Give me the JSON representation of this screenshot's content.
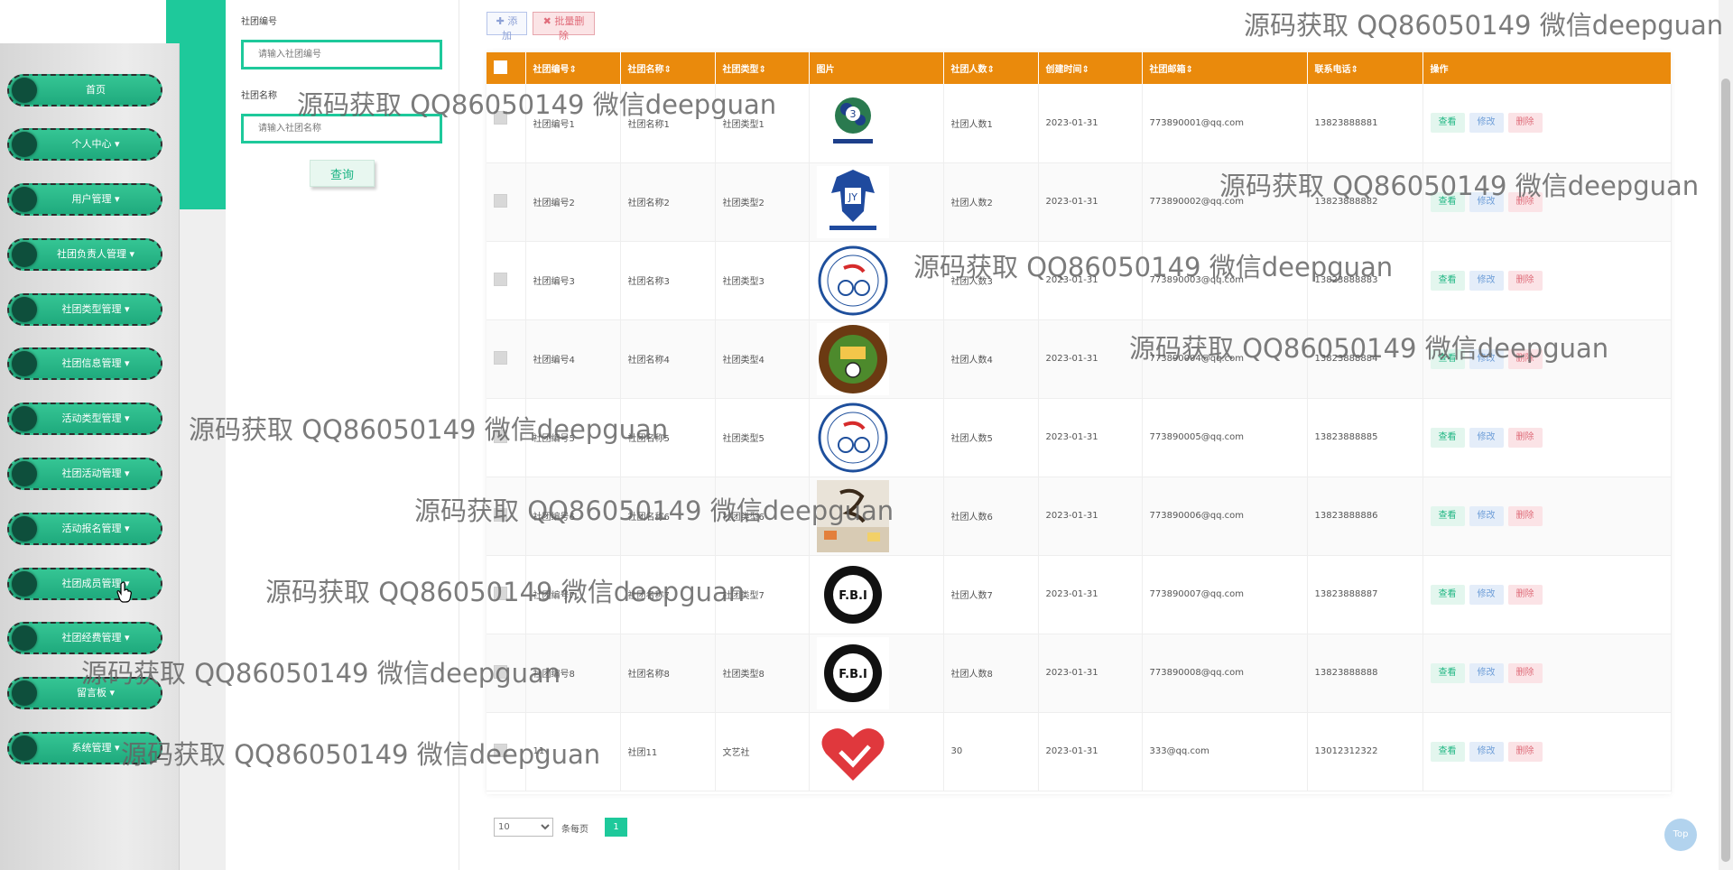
{
  "sidebar": {
    "items": [
      {
        "label": "首页"
      },
      {
        "label": "个人中心 ▾"
      },
      {
        "label": "用户管理 ▾"
      },
      {
        "label": "社团负责人管理 ▾"
      },
      {
        "label": "社团类型管理 ▾"
      },
      {
        "label": "社团信息管理 ▾"
      },
      {
        "label": "活动类型管理 ▾"
      },
      {
        "label": "社团活动管理 ▾"
      },
      {
        "label": "活动报名管理 ▾"
      },
      {
        "label": "社团成员管理 ▾"
      },
      {
        "label": "社团经费管理 ▾"
      },
      {
        "label": "留言板 ▾"
      },
      {
        "label": "系统管理 ▾"
      }
    ]
  },
  "search": {
    "field1_label": "社团编号",
    "field1_placeholder": "请输入社团编号",
    "field2_label": "社团名称",
    "field2_placeholder": "请输入社团名称",
    "query_button": "查询"
  },
  "toolbar": {
    "add_label": "✚ 添加",
    "batch_delete_label": "✖ 批量删除"
  },
  "table": {
    "headers": [
      "",
      "社团编号⇕",
      "社团名称⇕",
      "社团类型⇕",
      "图片",
      "社团人数⇕",
      "创建时间⇕",
      "社团邮箱⇕",
      "联系电话⇕",
      "操作"
    ],
    "action_labels": {
      "view": "查看",
      "edit": "修改",
      "delete": "删除"
    },
    "rows": [
      {
        "code": "社团编号1",
        "name": "社团名称1",
        "type": "社团类型1",
        "image": "basketball-club-logo",
        "members": "社团人数1",
        "created": "2023-01-31",
        "email": "773890001@qq.com",
        "phone": "13823888881"
      },
      {
        "code": "社团编号2",
        "name": "社团名称2",
        "type": "社团类型2",
        "image": "eagle-crest-logo",
        "members": "社团人数2",
        "created": "2023-01-31",
        "email": "773890002@qq.com",
        "phone": "13823888882"
      },
      {
        "code": "社团编号3",
        "name": "社团名称3",
        "type": "社团类型3",
        "image": "cycling-club-logo",
        "members": "社团人数3",
        "created": "2023-01-31",
        "email": "773890003@qq.com",
        "phone": "13823888883"
      },
      {
        "code": "社团编号4",
        "name": "社团名称4",
        "type": "社团类型4",
        "image": "football-association-logo",
        "members": "社团人数4",
        "created": "2023-01-31",
        "email": "773890004@qq.com",
        "phone": "13823888884"
      },
      {
        "code": "社团编号5",
        "name": "社团名称5",
        "type": "社团类型5",
        "image": "cycling-club-logo",
        "members": "社团人数5",
        "created": "2023-01-31",
        "email": "773890005@qq.com",
        "phone": "13823888885"
      },
      {
        "code": "社团编号6",
        "name": "社团名称6",
        "type": "社团类型6",
        "image": "calligraphy-photo",
        "members": "社团人数6",
        "created": "2023-01-31",
        "email": "773890006@qq.com",
        "phone": "13823888886"
      },
      {
        "code": "社团编号7",
        "name": "社团名称7",
        "type": "社团类型7",
        "image": "fbi-badge-logo",
        "members": "社团人数7",
        "created": "2023-01-31",
        "email": "773890007@qq.com",
        "phone": "13823888887"
      },
      {
        "code": "社团编号8",
        "name": "社团名称8",
        "type": "社团类型8",
        "image": "fbi-badge-logo",
        "members": "社团人数8",
        "created": "2023-01-31",
        "email": "773890008@qq.com",
        "phone": "13823888888"
      },
      {
        "code": "11",
        "name": "社团11",
        "type": "文艺社",
        "image": "heart-hand-logo",
        "members": "30",
        "created": "2023-01-31",
        "email": "333@qq.com",
        "phone": "13012312322"
      }
    ]
  },
  "pagination": {
    "page_size": "10",
    "per_page_label": "条每页",
    "current_page": "1"
  },
  "top_button": "Top",
  "watermark": "源码获取 QQ86050149 微信deepguan",
  "colors": {
    "accent": "#1ec99b",
    "header": "#ea8a0c",
    "menu": "#27b487"
  }
}
